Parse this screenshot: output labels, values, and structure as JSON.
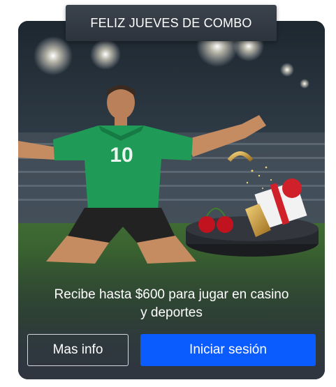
{
  "promo": {
    "badge_title": "FELIZ JUEVES DE COMBO",
    "description_line1": "Recibe hasta $600 para jugar en casino",
    "description_line2": "y deportes",
    "jersey_number": "10"
  },
  "actions": {
    "more_info_label": "Mas info",
    "login_label": "Iniciar sesión"
  },
  "colors": {
    "card_bg": "#2f3640",
    "login_button": "#0a5cff",
    "jersey": "#1f9a57"
  }
}
